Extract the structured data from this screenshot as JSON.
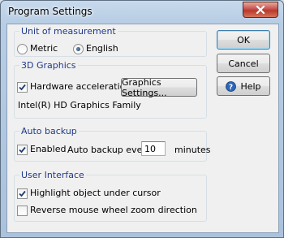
{
  "window": {
    "title": "Program Settings"
  },
  "unit": {
    "group_label": "Unit of measurement",
    "options": [
      {
        "label": "Metric",
        "selected": false
      },
      {
        "label": "English",
        "selected": true
      }
    ]
  },
  "graphics": {
    "group_label": "3D Graphics",
    "hw_accel_label": "Hardware acceleration",
    "hw_accel_checked": true,
    "settings_button": "Graphics Settings...",
    "device_name": "Intel(R) HD Graphics Family"
  },
  "backup": {
    "group_label": "Auto backup",
    "enabled_label": "Enabled",
    "enabled_checked": true,
    "every_label": "Auto backup every:",
    "interval_value": "10",
    "unit_label": "minutes"
  },
  "ui": {
    "group_label": "User Interface",
    "highlight_label": "Highlight object under cursor",
    "highlight_checked": true,
    "reverse_wheel_label": "Reverse mouse wheel zoom direction",
    "reverse_wheel_checked": false
  },
  "buttons": {
    "ok": "OK",
    "cancel": "Cancel",
    "help": "Help"
  },
  "icons": {
    "close": "close-icon",
    "help": "help-icon",
    "check": "checkmark-icon"
  }
}
